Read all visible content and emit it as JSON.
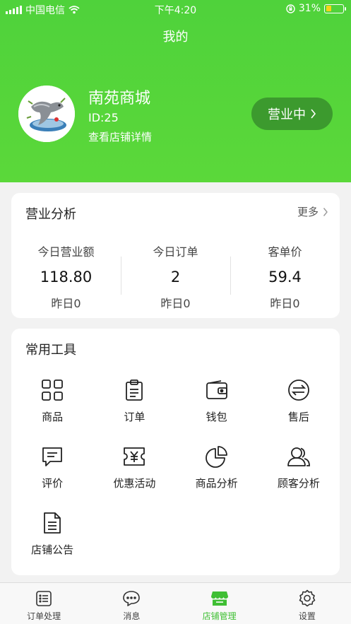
{
  "status_bar": {
    "carrier": "中国电信",
    "time": "下午4:20",
    "battery": "31%"
  },
  "page": {
    "title": "我的"
  },
  "shop": {
    "name": "南苑商城",
    "id": "ID:25",
    "detail_link": "查看店铺详情",
    "status": "营业中"
  },
  "analysis": {
    "title": "营业分析",
    "more": "更多",
    "stats": [
      {
        "label": "今日营业额",
        "value": "118.80",
        "prev": "昨日0"
      },
      {
        "label": "今日订单",
        "value": "2",
        "prev": "昨日0"
      },
      {
        "label": "客单价",
        "value": "59.4",
        "prev": "昨日0"
      }
    ]
  },
  "tools": {
    "title": "常用工具",
    "items": [
      {
        "label": "商品",
        "icon": "grid-icon"
      },
      {
        "label": "订单",
        "icon": "clipboard-icon"
      },
      {
        "label": "钱包",
        "icon": "wallet-icon"
      },
      {
        "label": "售后",
        "icon": "exchange-icon"
      },
      {
        "label": "评价",
        "icon": "comment-icon"
      },
      {
        "label": "优惠活动",
        "icon": "coupon-icon"
      },
      {
        "label": "商品分析",
        "icon": "pie-chart-icon"
      },
      {
        "label": "顾客分析",
        "icon": "users-icon"
      },
      {
        "label": "店铺公告",
        "icon": "document-icon"
      }
    ]
  },
  "tabbar": {
    "items": [
      {
        "label": "订单处理",
        "icon": "order-list-icon"
      },
      {
        "label": "消息",
        "icon": "message-icon"
      },
      {
        "label": "店铺管理",
        "icon": "store-icon",
        "active": true
      },
      {
        "label": "设置",
        "icon": "gear-icon"
      }
    ]
  },
  "colors": {
    "brand_green": "#4fd23b",
    "status_button": "#3c9a2e",
    "active_tab": "#3fbf34"
  }
}
